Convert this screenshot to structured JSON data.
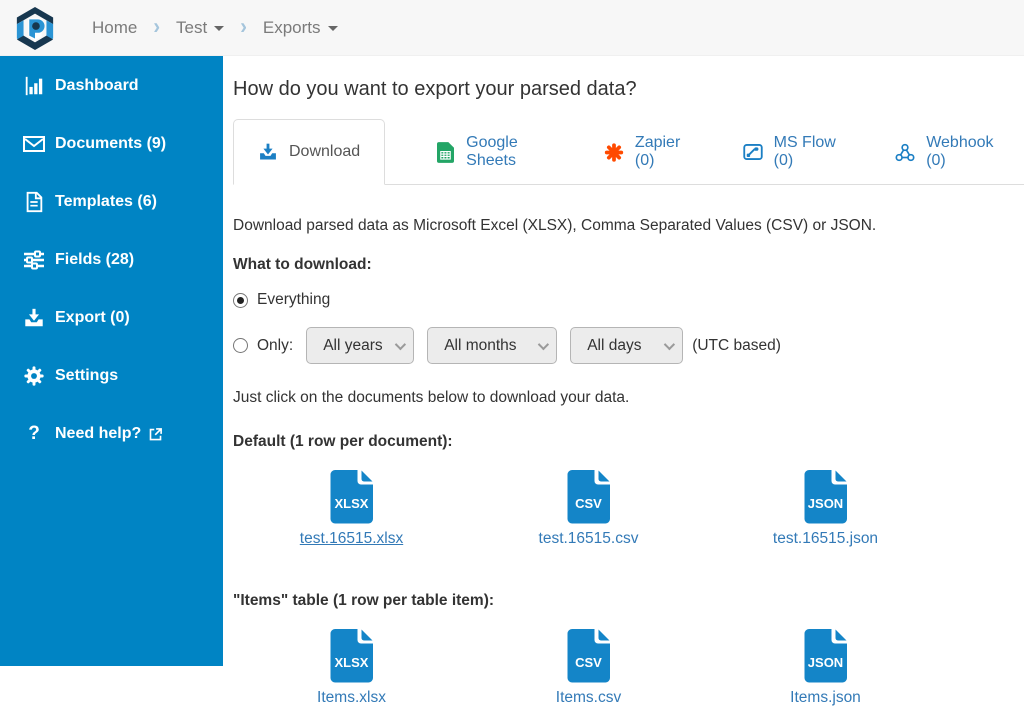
{
  "topbar": {
    "breadcrumb": [
      {
        "label": "Home",
        "dropdown": false
      },
      {
        "label": "Test",
        "dropdown": true
      },
      {
        "label": "Exports",
        "dropdown": true
      }
    ]
  },
  "sidebar": {
    "items": [
      {
        "label": "Dashboard",
        "icon": "bar-chart-icon"
      },
      {
        "label": "Documents (9)",
        "icon": "envelope-icon"
      },
      {
        "label": "Templates (6)",
        "icon": "file-text-icon"
      },
      {
        "label": "Fields (28)",
        "icon": "sliders-icon"
      },
      {
        "label": "Export (0)",
        "icon": "download-icon"
      },
      {
        "label": "Settings",
        "icon": "gear-icon"
      },
      {
        "label": "Need help?",
        "icon": "question-icon",
        "external_link": true
      }
    ]
  },
  "main": {
    "title": "How do you want to export your parsed data?",
    "tabs": [
      {
        "label": "Download",
        "icon": "download-icon",
        "active": true
      },
      {
        "label": "Google Sheets",
        "icon": "google-sheets-icon",
        "active": false
      },
      {
        "label": "Zapier (0)",
        "icon": "zapier-icon",
        "active": false
      },
      {
        "label": "MS Flow (0)",
        "icon": "ms-flow-icon",
        "active": false
      },
      {
        "label": "Webhook (0)",
        "icon": "webhook-icon",
        "active": false
      }
    ],
    "intro": "Download parsed data as Microsoft Excel (XLSX), Comma Separated Values (CSV) or JSON.",
    "what_to_download": {
      "label": "What to download:",
      "option_everything": {
        "label": "Everything",
        "selected": true
      },
      "option_only": {
        "label": "Only:",
        "selected": false
      },
      "selects": {
        "years": "All years",
        "months": "All months",
        "days": "All days"
      },
      "utc_note": "(UTC based)"
    },
    "click_hint": "Just click on the documents below to download your data.",
    "sections": [
      {
        "heading": "Default (1 row per document):",
        "files": [
          {
            "type": "XLSX",
            "name": "test.16515.xlsx",
            "underlined": true
          },
          {
            "type": "CSV",
            "name": "test.16515.csv",
            "underlined": false
          },
          {
            "type": "JSON",
            "name": "test.16515.json",
            "underlined": false
          }
        ]
      },
      {
        "heading": "\"Items\" table (1 row per table item):",
        "files": [
          {
            "type": "XLSX",
            "name": "Items.xlsx",
            "underlined": false
          },
          {
            "type": "CSV",
            "name": "Items.csv",
            "underlined": false
          },
          {
            "type": "JSON",
            "name": "Items.json",
            "underlined": false
          }
        ]
      }
    ]
  },
  "colors": {
    "sidebar_blue": "#0084c4",
    "link_blue": "#337ab7",
    "file_icon_blue": "#1485c8",
    "zapier_orange": "#ff4a00",
    "sheets_green": "#23a566",
    "topbar_gray": "#f7f7f7"
  }
}
